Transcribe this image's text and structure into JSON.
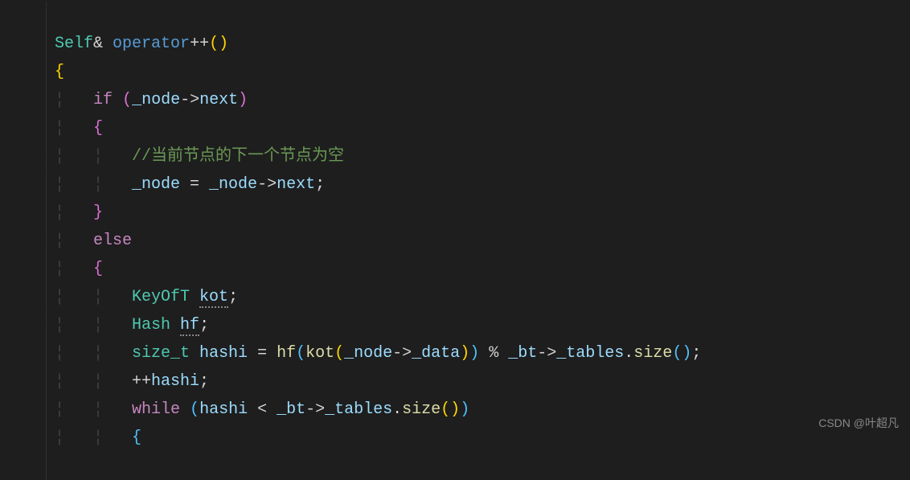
{
  "code": {
    "l1": {
      "type": "Self",
      "amp": "&",
      "op": "operator",
      "inc": "++",
      "p": "()"
    },
    "l2": {
      "brace": "{"
    },
    "l3": {
      "kw": "if",
      "po": "(",
      "v1": "_node",
      "arrow": "->",
      "v2": "next",
      "pc": ")"
    },
    "l4": {
      "brace": "{"
    },
    "l5": {
      "comment": "//当前节点的下一个节点为空"
    },
    "l6": {
      "v1": "_node",
      "eq": " = ",
      "v2": "_node",
      "arrow": "->",
      "v3": "next",
      "semi": ";"
    },
    "l7": {
      "brace": "}"
    },
    "l8": {
      "kw": "else"
    },
    "l9": {
      "brace": "{"
    },
    "l10": {
      "type": "KeyOfT",
      "var": "kot",
      "semi": ";"
    },
    "l11": {
      "type": "Hash",
      "var": "hf",
      "semi": ";"
    },
    "l12": {
      "type": "size_t",
      "var": "hashi",
      "eq": " = ",
      "fn1": "hf",
      "po1": "(",
      "fn2": "kot",
      "po2": "(",
      "v1": "_node",
      "arrow1": "->",
      "v2": "_data",
      "pc2": ")",
      "pc1": ")",
      "mod": " % ",
      "v3": "_bt",
      "arrow2": "->",
      "v4": "_tables",
      "dot": ".",
      "fn3": "size",
      "po3": "(",
      "pc3": ")",
      "semi": ";"
    },
    "l13": {
      "inc": "++",
      "var": "hashi",
      "semi": ";"
    },
    "l14": {
      "kw": "while",
      "po": "(",
      "v1": "hashi",
      "lt": " < ",
      "v2": "_bt",
      "arrow": "->",
      "v3": "_tables",
      "dot": ".",
      "fn": "size",
      "po2": "()",
      "pc": ")"
    },
    "l15": {
      "brace": "{"
    }
  },
  "watermark": "CSDN @叶超凡"
}
